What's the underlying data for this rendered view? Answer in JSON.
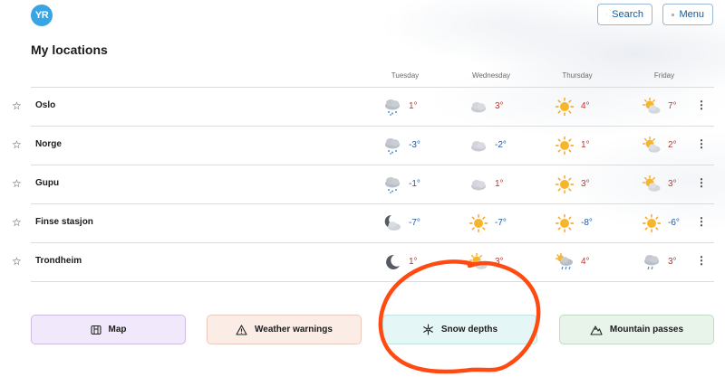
{
  "header": {
    "logo_text": "YR",
    "search_label": "Search",
    "menu_label": "Menu"
  },
  "page": {
    "title": "My locations"
  },
  "days": [
    "Tuesday",
    "Wednesday",
    "Thursday",
    "Friday"
  ],
  "locations": [
    {
      "name": "Oslo",
      "forecast": [
        {
          "icon": "snow-cloud-icon",
          "temp": "1°",
          "tone": "warm"
        },
        {
          "icon": "cloud-icon",
          "temp": "3°",
          "tone": "warm"
        },
        {
          "icon": "sun-icon",
          "temp": "4°",
          "tone": "warm"
        },
        {
          "icon": "partly-cloudy-icon",
          "temp": "7°",
          "tone": "warm"
        }
      ]
    },
    {
      "name": "Norge",
      "forecast": [
        {
          "icon": "snow-cloud-icon",
          "temp": "-3°",
          "tone": "cold"
        },
        {
          "icon": "cloud-icon",
          "temp": "-2°",
          "tone": "cold"
        },
        {
          "icon": "sun-icon",
          "temp": "1°",
          "tone": "warm"
        },
        {
          "icon": "partly-cloudy-icon",
          "temp": "2°",
          "tone": "warm"
        }
      ]
    },
    {
      "name": "Gupu",
      "forecast": [
        {
          "icon": "snow-cloud-icon",
          "temp": "-1°",
          "tone": "cold"
        },
        {
          "icon": "cloud-icon",
          "temp": "1°",
          "tone": "warm"
        },
        {
          "icon": "sun-icon",
          "temp": "3°",
          "tone": "warm"
        },
        {
          "icon": "partly-cloudy-icon",
          "temp": "3°",
          "tone": "warm"
        }
      ]
    },
    {
      "name": "Finse stasjon",
      "forecast": [
        {
          "icon": "moon-cloud-icon",
          "temp": "-7°",
          "tone": "cold"
        },
        {
          "icon": "sun-icon",
          "temp": "-7°",
          "tone": "cold"
        },
        {
          "icon": "sun-icon",
          "temp": "-8°",
          "tone": "cold"
        },
        {
          "icon": "sun-icon",
          "temp": "-6°",
          "tone": "cold"
        }
      ]
    },
    {
      "name": "Trondheim",
      "forecast": [
        {
          "icon": "moon-icon",
          "temp": "1°",
          "tone": "warm"
        },
        {
          "icon": "partly-cloudy-icon",
          "temp": "3°",
          "tone": "warm"
        },
        {
          "icon": "sun-rain-cloud-icon",
          "temp": "4°",
          "tone": "warm"
        },
        {
          "icon": "rain-cloud-icon",
          "temp": "3°",
          "tone": "warm"
        }
      ]
    }
  ],
  "tiles": [
    {
      "label": "Map",
      "icon": "map-icon"
    },
    {
      "label": "Weather warnings",
      "icon": "warning-icon"
    },
    {
      "label": "Snow depths",
      "icon": "snowflake-icon"
    },
    {
      "label": "Mountain passes",
      "icon": "mountain-icon"
    }
  ],
  "colors": {
    "brand": "#38a4e4",
    "warm_temp": "#c0332b",
    "cold_temp": "#1f5aa6",
    "annotation": "#ff4a12"
  }
}
